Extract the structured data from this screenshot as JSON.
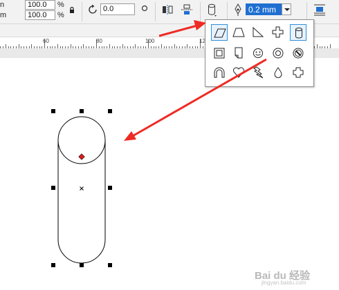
{
  "toolbar": {
    "scale_x": "100.0",
    "scale_y": "100.0",
    "percent_sign": "%",
    "rotation_angle": "0.0",
    "outline_width": "0.2 mm"
  },
  "ruler": {
    "labels": [
      "60",
      "80",
      "100",
      "12"
    ]
  },
  "watermark": {
    "text": "Bai du 经验",
    "sub": "jingyan.baidu.com"
  },
  "colors": {
    "arrow": "#ee2b24",
    "accent": "#1f6fd1",
    "selection": "#2f8ed8",
    "center_marker": "#e21b1b"
  },
  "icons": [
    "lock-icon",
    "rotate-icon",
    "circle-icon",
    "mirror-horizontal-icon",
    "mirror-vertical-icon",
    "perfect-shapes-icon",
    "pen-nib-icon",
    "wrap-text-icon",
    "parallelogram-icon",
    "trapezoid-icon",
    "right-triangle-icon",
    "cross-icon",
    "cylinder-icon",
    "frame-icon",
    "folded-page-icon",
    "smiley-icon",
    "ring-icon",
    "no-symbol-icon",
    "arch-icon",
    "heart-icon",
    "lightning-icon",
    "teardrop-icon",
    "octagon-plus-icon"
  ]
}
